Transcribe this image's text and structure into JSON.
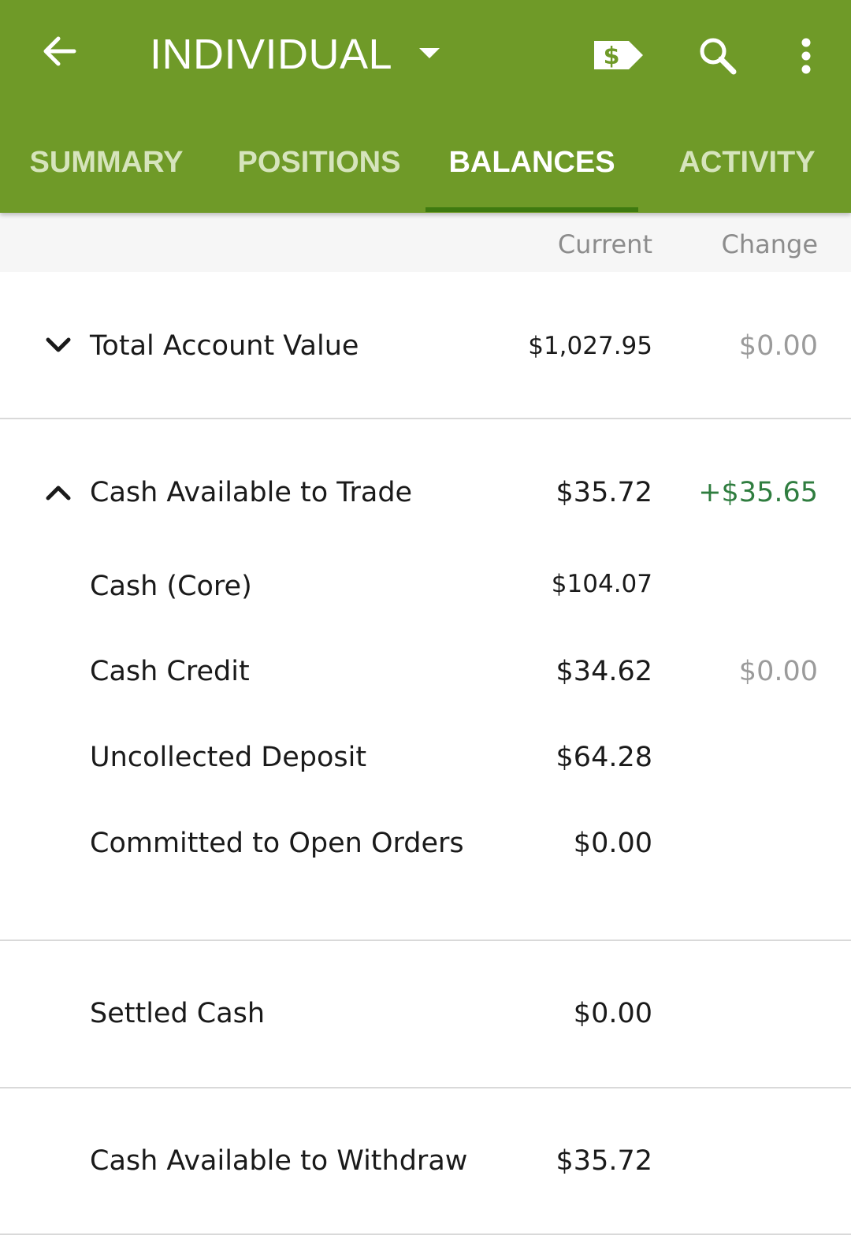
{
  "header": {
    "title": "INDIVIDUAL",
    "icons": {
      "back": "arrow-left-icon",
      "dropdown": "caret-down-icon",
      "transfer": "dollar-transfer-icon",
      "search": "search-icon",
      "more": "more-vertical-icon"
    },
    "background_color": "#6f9a28"
  },
  "tabs": [
    {
      "label": "SUMMARY",
      "active": false
    },
    {
      "label": "POSITIONS",
      "active": false
    },
    {
      "label": "BALANCES",
      "active": true
    },
    {
      "label": "ACTIVITY",
      "active": false
    }
  ],
  "columns": {
    "current": "Current",
    "change": "Change"
  },
  "rows": {
    "total_account_value": {
      "label": "Total Account Value",
      "current": "$1,027.95",
      "change": "$0.00",
      "expanded": false
    },
    "cash_available_to_trade": {
      "label": "Cash Available to Trade",
      "current": "$35.72",
      "change": "+$35.65",
      "expanded": true
    },
    "cash_core": {
      "label": "Cash (Core)",
      "current": "$104.07"
    },
    "cash_credit": {
      "label": "Cash Credit",
      "current": "$34.62",
      "change": "$0.00"
    },
    "uncollected_deposit": {
      "label": "Uncollected Deposit",
      "current": "$64.28"
    },
    "committed_to_open_orders": {
      "label": "Committed to Open Orders",
      "current": "$0.00"
    },
    "settled_cash": {
      "label": "Settled Cash",
      "current": "$0.00"
    },
    "cash_available_to_withdraw": {
      "label": "Cash Available to Withdraw",
      "current": "$35.72"
    }
  },
  "colors": {
    "positive_change": "#2f7d3f",
    "neutral_change": "#9b9b9b",
    "tab_active": "#ffffff",
    "tab_inactive": "#d6e4bc"
  }
}
